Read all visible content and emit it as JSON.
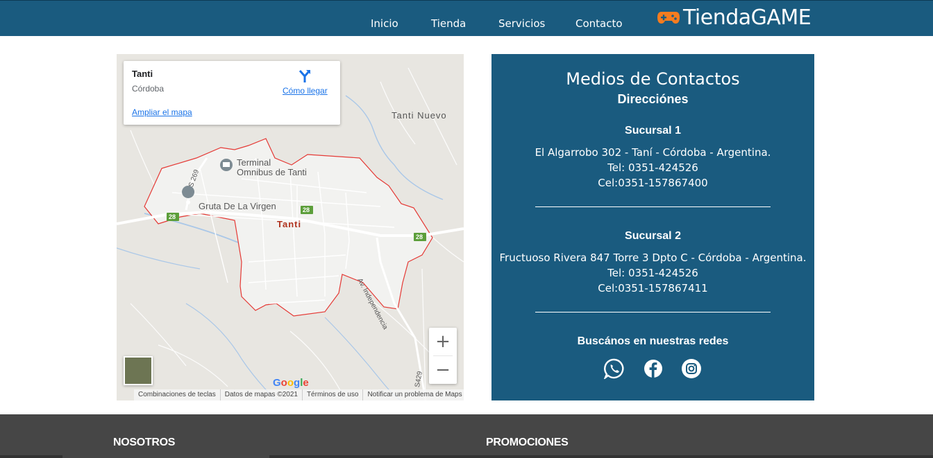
{
  "header": {
    "nav": [
      "Inicio",
      "Tienda",
      "Servicios",
      "Contacto"
    ],
    "logo_text": "TiendaGAME",
    "logo_icon": "gamepad-icon",
    "colors": {
      "bar": "#1a5b7f",
      "logo_icon": "#f57c1f"
    }
  },
  "map": {
    "place": "Tanti",
    "region": "Córdoba",
    "directions_label": "Cómo llegar",
    "enlarge_label": "Ampliar el mapa",
    "labels": {
      "tanti_nuevo": "Tanti Nuevo",
      "terminal_line1": "Terminal",
      "terminal_line2": "Omnibus de Tanti",
      "gruta": "Gruta De La Virgen",
      "tanti": "Tanti",
      "avenida": "Av. Independencia",
      "s269": "S 269",
      "s429": "S429",
      "route_28": "28"
    },
    "zoom_in": "+",
    "zoom_out": "−",
    "google": "Google",
    "footer": [
      "Combinaciones de teclas",
      "Datos de mapas ©2021",
      "Términos de uso",
      "Notificar un problema de Maps"
    ]
  },
  "contact": {
    "title": "Medios de Contactos",
    "subtitle": "Direcciónes",
    "branches": [
      {
        "name": "Sucursal 1",
        "address": "El Algarrobo 302 - Taní - Córdoba - Argentina.",
        "tel": "Tel: 0351-424526",
        "cel": "Cel:0351-157867400"
      },
      {
        "name": "Sucursal 2",
        "address": "Fructuoso Rivera 847 Torre 3 Dpto C - Córdoba - Argentina.",
        "tel": "Tel: 0351-424526",
        "cel": "Cel:0351-157867411"
      }
    ],
    "social_title": "Buscános en nuestras redes",
    "social_icons": [
      "whatsapp-icon",
      "facebook-icon",
      "instagram-icon"
    ]
  },
  "footer": {
    "columns": [
      "NOSOTROS",
      "PROMOCIONES"
    ]
  }
}
